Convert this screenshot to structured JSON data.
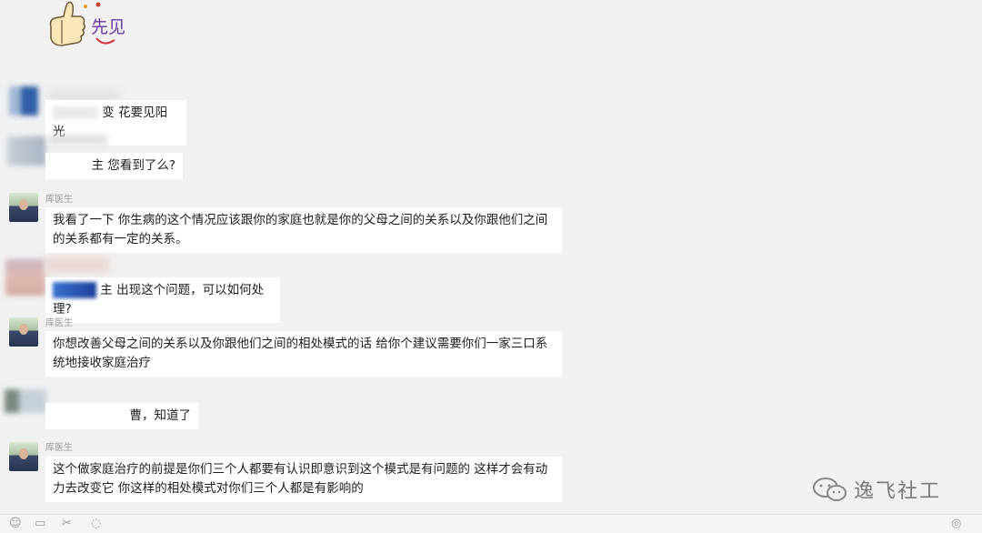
{
  "messages": {
    "m1": {
      "text": "变 花要见阳光"
    },
    "m2": {
      "text": "主 您看到了么?"
    },
    "m3": {
      "sender": "库医生",
      "text": "我看了一下 你生病的这个情况应该跟你的家庭也就是你的父母之间的关系以及你跟他们之间的关系都有一定的关系。"
    },
    "m4": {
      "text": "主 出现这个问题，可以如何处理?"
    },
    "m5": {
      "sender": "库医生",
      "text": "你想改善父母之间的关系以及你跟他们之间的相处模式的话 给你个建议需要你们一家三口系统地接收家庭治疗"
    },
    "m6": {
      "text": "曹，知道了"
    },
    "m7": {
      "sender": "库医生",
      "text": "这个做家庭治疗的前提是你们三个人都要有认识即意识到这个模式是有问题的 这样才会有动力去改变它 你这样的相处模式对你们三个人都是有影响的"
    }
  },
  "sticker": {
    "text": "先见",
    "icon": "thumbs-up-icon"
  },
  "watermark": {
    "text": "逸飞社工"
  },
  "toolbar": {
    "icons": [
      "emoji-icon",
      "folder-icon",
      "scissors-icon",
      "chat-icon",
      "voice-icon"
    ]
  }
}
